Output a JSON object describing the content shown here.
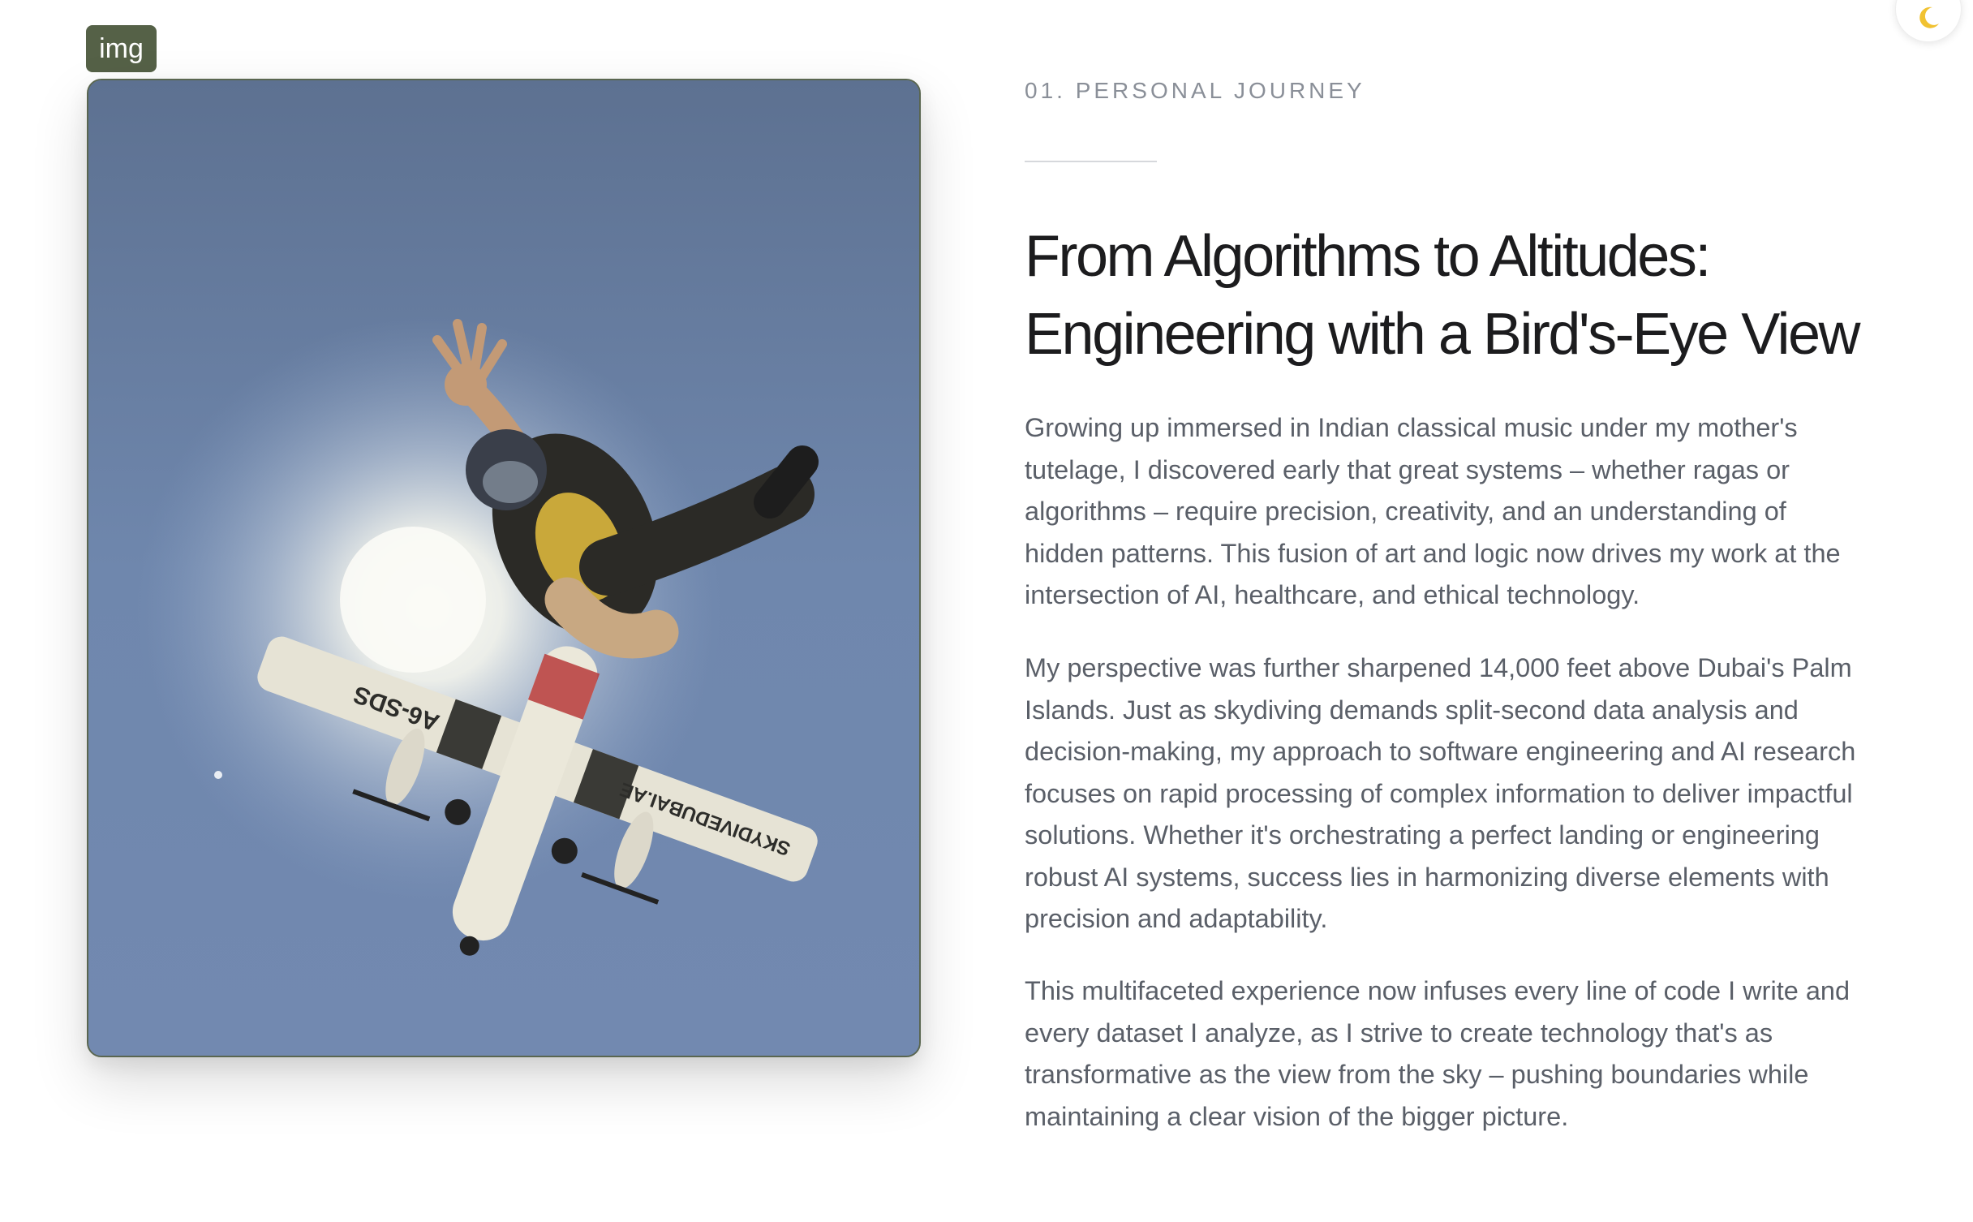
{
  "theme_toggle": {
    "icon": "moon-icon"
  },
  "image_tag": {
    "label": "img"
  },
  "photo": {
    "aircraft_registration": "A6-SDS",
    "wing_text": "SKYDIVEDUBAI.AE"
  },
  "section": {
    "eyebrow": "01. PERSONAL JOURNEY",
    "title_line1": "From Algorithms to Altitudes:",
    "title_line2": "Engineering with a Bird's-Eye View",
    "paragraphs": [
      "Growing up immersed in Indian classical music under my mother's tutelage, I discovered early that great systems – whether ragas or algorithms – require precision, creativity, and an understanding of hidden patterns. This fusion of art and logic now drives my work at the intersection of AI, healthcare, and ethical technology.",
      "My perspective was further sharpened 14,000 feet above Dubai's Palm Islands. Just as skydiving demands split-second data analysis and decision-making, my approach to software engineering and AI research focuses on rapid processing of complex information to deliver impactful solutions. Whether it's orchestrating a perfect landing or engineering robust AI systems, success lies in harmonizing diverse elements with precision and adaptability.",
      "This multifaceted experience now infuses every line of code I write and every dataset I analyze, as I strive to create technology that's as transformative as the view from the sky – pushing boundaries while maintaining a clear vision of the bigger picture."
    ]
  },
  "colors": {
    "tag_bg": "#556147",
    "sky_top": "#5d7191",
    "sky_bottom": "#7289b0",
    "heading": "#1c1c1e",
    "body": "#5a5f68",
    "eyebrow": "#8a8f98"
  }
}
